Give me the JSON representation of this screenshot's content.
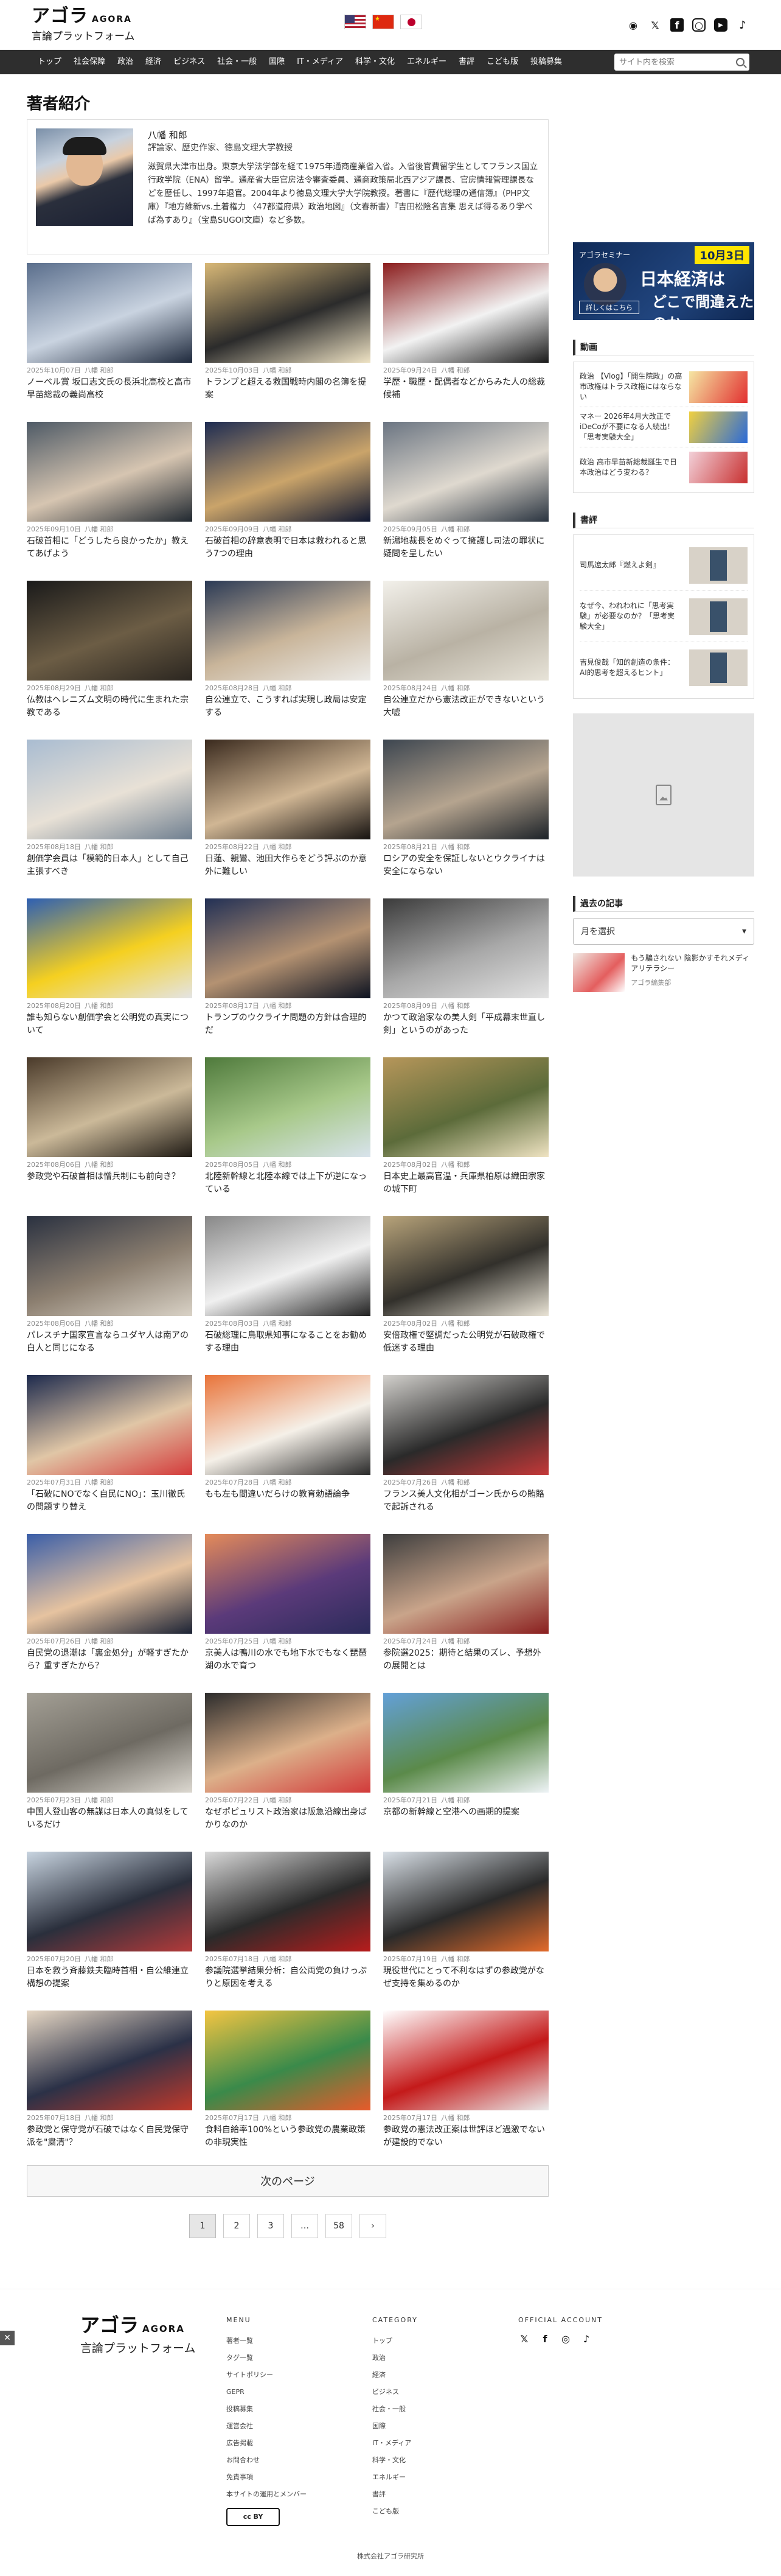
{
  "header": {
    "logo_main": "アゴラ",
    "logo_agora": "AGORA",
    "logo_sub": "言論プラットフォーム",
    "flags": [
      "us-flag",
      "cn-flag",
      "jp-flag"
    ],
    "social": [
      "rss-icon",
      "x-icon",
      "facebook-icon",
      "instagram-icon",
      "youtube-icon",
      "tiktok-icon"
    ]
  },
  "nav": {
    "items": [
      "トップ",
      "社会保障",
      "政治",
      "経済",
      "ビジネス",
      "社会・一般",
      "国際",
      "IT・メディア",
      "科学・文化",
      "エネルギー",
      "書評",
      "こども版",
      "投稿募集"
    ],
    "search_placeholder": "サイト内を検索"
  },
  "page": {
    "title": "著者紹介"
  },
  "author": {
    "name": "八幡 和郎",
    "role": "評論家、歴史作家、徳島文理大学教授",
    "bio": "滋賀県大津市出身。東京大学法学部を経て1975年通商産業省入省。入省後官費留学生としてフランス国立行政学院（ENA）留学。通産省大臣官房法令審査委員、通商政策局北西アジア課長、官房情報管理課長などを歴任し、1997年退官。2004年より徳島文理大学大学院教授。著書に『歴代総理の通信簿』（PHP文庫）『地方維新vs.土着権力 〈47都道府県〉政治地図』（文春新書）『吉田松陰名言集 思えば得るあり学べば為すあり』（宝島SUGOI文庫）など多数。"
  },
  "articles": [
    {
      "date": "2025年10月07日",
      "author": "八幡 和郎",
      "title": "ノーベル賞 坂口志文氏の長浜北高校と高市早苗総裁の義尚高校"
    },
    {
      "date": "2025年10月03日",
      "author": "八幡 和郎",
      "title": "トランプと超える救国戦時内閣の名簿を提案"
    },
    {
      "date": "2025年09月24日",
      "author": "八幡 和郎",
      "title": "学歴・職歴・配偶者などからみた人の総裁候補"
    },
    {
      "date": "2025年09月10日",
      "author": "八幡 和郎",
      "title": "石破首相に「どうしたら良かったか」教えてあげよう"
    },
    {
      "date": "2025年09月09日",
      "author": "八幡 和郎",
      "title": "石破首相の辞意表明で日本は救われると思う7つの理由"
    },
    {
      "date": "2025年09月05日",
      "author": "八幡 和郎",
      "title": "新潟地裁長をめぐって擁護し司法の罪状に疑問を呈したい"
    },
    {
      "date": "2025年08月29日",
      "author": "八幡 和郎",
      "title": "仏教はヘレニズム文明の時代に生まれた宗教である"
    },
    {
      "date": "2025年08月28日",
      "author": "八幡 和郎",
      "title": "自公連立で、こうすれば実現し政局は安定する"
    },
    {
      "date": "2025年08月24日",
      "author": "八幡 和郎",
      "title": "自公連立だから憲法改正ができないという大嘘"
    },
    {
      "date": "2025年08月18日",
      "author": "八幡 和郎",
      "title": "創価学会員は「模範的日本人」として自己主張すべき"
    },
    {
      "date": "2025年08月22日",
      "author": "八幡 和郎",
      "title": "日蓮、親鸞、池田大作らをどう評ぶのか意外に難しい"
    },
    {
      "date": "2025年08月21日",
      "author": "八幡 和郎",
      "title": "ロシアの安全を保証しないとウクライナは安全にならない"
    },
    {
      "date": "2025年08月20日",
      "author": "八幡 和郎",
      "title": "誰も知らない創価学会と公明党の真実について"
    },
    {
      "date": "2025年08月17日",
      "author": "八幡 和郎",
      "title": "トランプのウクライナ問題の方針は合理的だ"
    },
    {
      "date": "2025年08月09日",
      "author": "八幡 和郎",
      "title": "かつて政治家なの美人剣「平成幕末世直し剣」というのがあった"
    },
    {
      "date": "2025年08月06日",
      "author": "八幡 和郎",
      "title": "参政党や石破首相は憎兵制にも前向き？"
    },
    {
      "date": "2025年08月05日",
      "author": "八幡 和郎",
      "title": "北陸新幹線と北陸本線では上下が逆になっている"
    },
    {
      "date": "2025年08月02日",
      "author": "八幡 和郎",
      "title": "日本史上最高官温・兵庫県柏原は織田宗家の城下町"
    },
    {
      "date": "2025年08月06日",
      "author": "八幡 和郎",
      "title": "パレスチナ国家宣言ならユダヤ人は南アの白人と同じになる"
    },
    {
      "date": "2025年08月03日",
      "author": "八幡 和郎",
      "title": "石破総理に鳥取県知事になることをお勧めする理由"
    },
    {
      "date": "2025年08月02日",
      "author": "八幡 和郎",
      "title": "安倍政権で堅調だった公明党が石破政権で低迷する理由"
    },
    {
      "date": "2025年07月31日",
      "author": "八幡 和郎",
      "title": "「石破にNOでなく自民にNO」：玉川徹氏の問題すり替え"
    },
    {
      "date": "2025年07月28日",
      "author": "八幡 和郎",
      "title": "もも左も間違いだらけの教育勅語論争"
    },
    {
      "date": "2025年07月26日",
      "author": "八幡 和郎",
      "title": "フランス美人文化相がゴーン氏からの賄賂で起訴される"
    },
    {
      "date": "2025年07月26日",
      "author": "八幡 和郎",
      "title": "自民党の退潮は「裏金処分」が軽すぎたから？重すぎたから？"
    },
    {
      "date": "2025年07月25日",
      "author": "八幡 和郎",
      "title": "京美人は鴨川の水でも地下水でもなく琵琶湖の水で育つ"
    },
    {
      "date": "2025年07月24日",
      "author": "八幡 和郎",
      "title": "参院選2025：期待と結果のズレ、予想外の展開とは"
    },
    {
      "date": "2025年07月23日",
      "author": "八幡 和郎",
      "title": "中国人登山客の無謀は日本人の真似をしているだけ"
    },
    {
      "date": "2025年07月22日",
      "author": "八幡 和郎",
      "title": "なぜポピュリスト政治家は阪急沿線出身ばかりなのか"
    },
    {
      "date": "2025年07月21日",
      "author": "八幡 和郎",
      "title": "京都の新幹線と空港への画期的提案"
    },
    {
      "date": "2025年07月20日",
      "author": "八幡 和郎",
      "title": "日本を救う斉藤鉄夫臨時首相・自公維連立構想の提案"
    },
    {
      "date": "2025年07月18日",
      "author": "八幡 和郎",
      "title": "参議院選挙結果分析：自公両党の負けっぷりと原因を考える"
    },
    {
      "date": "2025年07月19日",
      "author": "八幡 和郎",
      "title": "現役世代にとって不利なはずの参政党がなぜ支持を集めるのか"
    },
    {
      "date": "2025年07月18日",
      "author": "八幡 和郎",
      "title": "参政党と保守党が石破ではなく自民党保守派を\"粛清\"？"
    },
    {
      "date": "2025年07月17日",
      "author": "八幡 和郎",
      "title": "食料自給率100%という参政党の農業政策の非現実性"
    },
    {
      "date": "2025年07月17日",
      "author": "八幡 和郎",
      "title": "参政党の憲法改正案は世評ほど過激でないが建設的でない"
    }
  ],
  "pagination": {
    "next_label": "次のページ",
    "pages": [
      "1",
      "2",
      "3",
      "…",
      "58",
      "›"
    ],
    "current": "1"
  },
  "sidebar": {
    "seminar": {
      "tag": "アゴラセミナー",
      "date": "10月3日",
      "headline1": "日本経済は",
      "headline2": "どこで間違えたのか",
      "button": "詳しくはこちら"
    },
    "videos_title": "動画",
    "videos": [
      {
        "text": "政治 【Vlog】「開生院政」の高市政権はトラス政権にはならない"
      },
      {
        "text": "マネー 2026年4月大改正でiDeCoが不要になる人続出！「思考実験大全」"
      },
      {
        "text": "政治 高市早苗新総裁誕生で日本政治はどう変わる？"
      }
    ],
    "books_title": "書評",
    "books": [
      {
        "text": "司馬遼太郎『燃えよ剣』"
      },
      {
        "text": "なぜ今、われわれに「思考実験」が必要なのか？「思考実験大全」"
      },
      {
        "text": "吉見俊哉「知的創造の条件：AI的思考を超えるヒント」"
      }
    ],
    "archive_title": "過去の記事",
    "archive_select": "月を選択",
    "archive_post": {
      "text": "もう騙されない 陰影かすそれメディアリテラシー",
      "source": "アゴラ編集部"
    }
  },
  "footer": {
    "logo_main": "アゴラ",
    "logo_agora": "AGORA",
    "logo_sub": "言論プラットフォーム",
    "menu_title": "MENU",
    "menu": [
      "著者一覧",
      "タグ一覧",
      "サイトポリシー",
      "GEPR",
      "投稿募集",
      "運営会社",
      "広告掲載",
      "お問合わせ",
      "免責事項",
      "本サイトの運用とメンバー"
    ],
    "category_title": "CATEGORY",
    "categories": [
      "トップ",
      "政治",
      "経済",
      "ビジネス",
      "社会・一般",
      "国際",
      "IT・メディア",
      "科学・文化",
      "エネルギー",
      "書評",
      "こども版"
    ],
    "official_title": "OFFICIAL ACCOUNT",
    "license": "cc BY",
    "copyright": "株式会社アゴラ研究所"
  }
}
